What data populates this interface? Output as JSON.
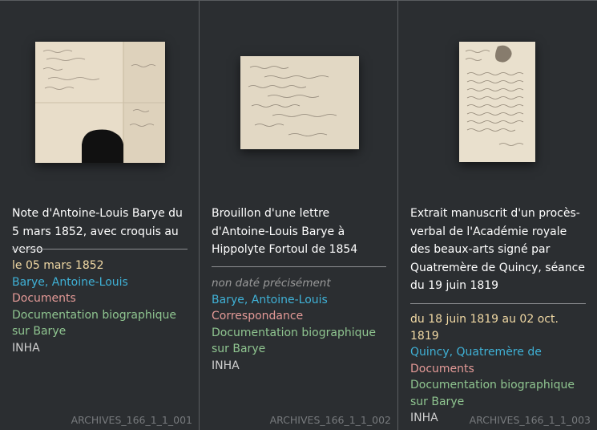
{
  "cards": [
    {
      "title": "Note d'Antoine-Louis Barye du 5 mars 1852, avec croquis au verso",
      "date": "le 05 mars 1852",
      "creator": "Barye, Antoine-Louis",
      "type": "Documents",
      "subject": "Documentation biographique sur Barye",
      "institution": "INHA",
      "reference": "ARCHIVES_166_1_1_001"
    },
    {
      "title": "Brouillon d'une lettre d'Antoine-Louis Barye à Hippolyte Fortoul de 1854",
      "date": "non daté précisément",
      "creator": "Barye, Antoine-Louis",
      "type": "Correspondance",
      "subject": "Documentation biographique sur Barye",
      "institution": "INHA",
      "reference": "ARCHIVES_166_1_1_002"
    },
    {
      "title": "Extrait manuscrit d'un procès-verbal de l'Académie royale des beaux-arts signé par Quatremère de Quincy, séance du 19 juin 1819",
      "date": "du 18 juin 1819 au 02 oct. 1819",
      "creator": "Quincy, Quatremère de",
      "type": "Documents",
      "subject": "Documentation biographique sur Barye",
      "institution": "INHA",
      "reference": "ARCHIVES_166_1_1_003"
    }
  ]
}
